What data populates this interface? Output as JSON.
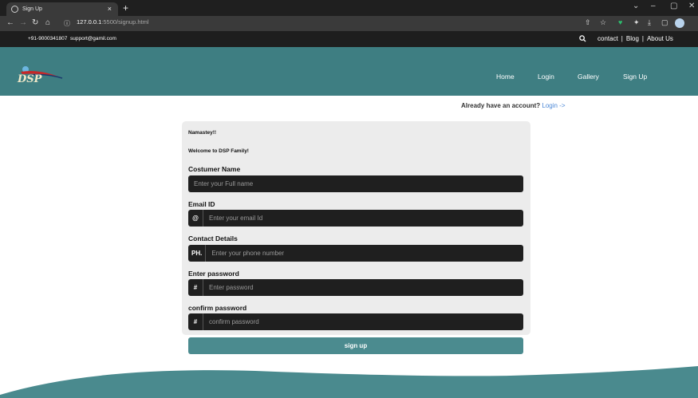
{
  "browser": {
    "tab_title": "Sign Up",
    "tab_close": "×",
    "new_tab": "+",
    "url_host": "127.0.0.1",
    "url_path": ":5500/signup.html",
    "window_controls": [
      "⌄",
      "–",
      "▢",
      "✕"
    ],
    "extensions": [
      "⇧",
      "☆",
      "♥",
      "✦",
      "⤓",
      "▢"
    ]
  },
  "topstrip": {
    "phone": "+91-9000341807",
    "email": "support@gamil.com",
    "search_icon": "search-icon",
    "links": [
      "contact",
      "|",
      "Blog",
      "|",
      "About Us"
    ]
  },
  "logo": {
    "text": "DSP"
  },
  "nav": {
    "items": [
      "Home",
      "Login",
      "Gallery",
      "Sign Up"
    ]
  },
  "account": {
    "prompt": "Already have an account?",
    "login_link": "Login ->"
  },
  "form": {
    "greeting": "Namastey!!",
    "welcome": "Welcome to DSP Family!",
    "name_label": "Costumer Name",
    "name_placeholder": "Enter your Full name",
    "email_label": "Email ID",
    "email_addon": "@",
    "email_placeholder": "Enter your email Id",
    "contact_label": "Contact Details",
    "contact_addon": "PH.",
    "contact_placeholder": "Enter your phone number",
    "password_label": "Enter password",
    "password_addon": "#",
    "password_placeholder": "Enter password",
    "confirm_label": "confirm password",
    "confirm_addon": "#",
    "confirm_placeholder": "confirm password",
    "submit_label": "sign up"
  },
  "colors": {
    "brand": "#3e7e82",
    "button": "#4b8b8f",
    "link": "#4a87d6"
  }
}
